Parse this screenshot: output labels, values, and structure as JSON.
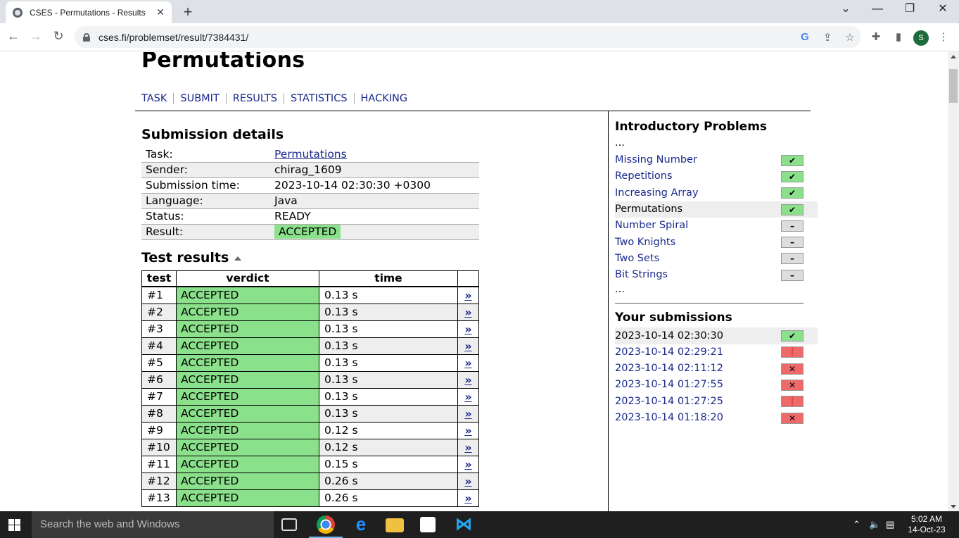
{
  "browser": {
    "tab_title": "CSES - Permutations - Results",
    "tab_close": "✕",
    "new_tab": "+",
    "url": "cses.fi/problemset/result/7384431/",
    "avatar_letter": "S",
    "window_controls": [
      "⌄",
      "—",
      "❐",
      "✕"
    ]
  },
  "page": {
    "title": "Permutations",
    "nav": [
      "TASK",
      "SUBMIT",
      "RESULTS",
      "STATISTICS",
      "HACKING"
    ]
  },
  "submission": {
    "heading": "Submission details",
    "rows": [
      {
        "key": "Task:",
        "value": "Permutations"
      },
      {
        "key": "Sender:",
        "value": "chirag_1609"
      },
      {
        "key": "Submission time:",
        "value": "2023-10-14 02:30:30 +0300"
      },
      {
        "key": "Language:",
        "value": "Java"
      },
      {
        "key": "Status:",
        "value": "READY"
      },
      {
        "key": "Result:",
        "value": "ACCEPTED"
      }
    ]
  },
  "tests": {
    "heading": "Test results",
    "columns": [
      "test",
      "verdict",
      "time"
    ],
    "arrow": "»",
    "rows": [
      {
        "test": "#1",
        "verdict": "ACCEPTED",
        "time": "0.13 s"
      },
      {
        "test": "#2",
        "verdict": "ACCEPTED",
        "time": "0.13 s"
      },
      {
        "test": "#3",
        "verdict": "ACCEPTED",
        "time": "0.13 s"
      },
      {
        "test": "#4",
        "verdict": "ACCEPTED",
        "time": "0.13 s"
      },
      {
        "test": "#5",
        "verdict": "ACCEPTED",
        "time": "0.13 s"
      },
      {
        "test": "#6",
        "verdict": "ACCEPTED",
        "time": "0.13 s"
      },
      {
        "test": "#7",
        "verdict": "ACCEPTED",
        "time": "0.13 s"
      },
      {
        "test": "#8",
        "verdict": "ACCEPTED",
        "time": "0.13 s"
      },
      {
        "test": "#9",
        "verdict": "ACCEPTED",
        "time": "0.12 s"
      },
      {
        "test": "#10",
        "verdict": "ACCEPTED",
        "time": "0.12 s"
      },
      {
        "test": "#11",
        "verdict": "ACCEPTED",
        "time": "0.15 s"
      },
      {
        "test": "#12",
        "verdict": "ACCEPTED",
        "time": "0.26 s"
      },
      {
        "test": "#13",
        "verdict": "ACCEPTED",
        "time": "0.26 s"
      }
    ]
  },
  "sidebar": {
    "heading": "Introductory Problems",
    "ellipsis": "...",
    "problems": [
      {
        "name": "Missing Number",
        "status": "ok",
        "icon": "✔"
      },
      {
        "name": "Repetitions",
        "status": "ok",
        "icon": "✔"
      },
      {
        "name": "Increasing Array",
        "status": "ok",
        "icon": "✔"
      },
      {
        "name": "Permutations",
        "status": "ok",
        "icon": "✔",
        "current": true
      },
      {
        "name": "Number Spiral",
        "status": "none",
        "icon": "–"
      },
      {
        "name": "Two Knights",
        "status": "none",
        "icon": "–"
      },
      {
        "name": "Two Sets",
        "status": "none",
        "icon": "–"
      },
      {
        "name": "Bit Strings",
        "status": "none",
        "icon": "–"
      }
    ],
    "submissions_heading": "Your submissions",
    "submissions": [
      {
        "time": "2023-10-14 02:30:30",
        "status": "ok",
        "icon": "✔",
        "current": true
      },
      {
        "time": "2023-10-14 02:29:21",
        "status": "err",
        "icon": "❗"
      },
      {
        "time": "2023-10-14 02:11:12",
        "status": "err",
        "icon": "✕"
      },
      {
        "time": "2023-10-14 01:27:55",
        "status": "err",
        "icon": "✕"
      },
      {
        "time": "2023-10-14 01:27:25",
        "status": "err",
        "icon": "❗"
      },
      {
        "time": "2023-10-14 01:18:20",
        "status": "err",
        "icon": "✕"
      }
    ]
  },
  "taskbar": {
    "search_placeholder": "Search the web and Windows",
    "time": "5:02 AM",
    "date": "14-Oct-23"
  },
  "colors": {
    "accepted_green": "#8be08b",
    "error_red": "#ee6a6a",
    "link_blue": "#1a2a8c"
  }
}
